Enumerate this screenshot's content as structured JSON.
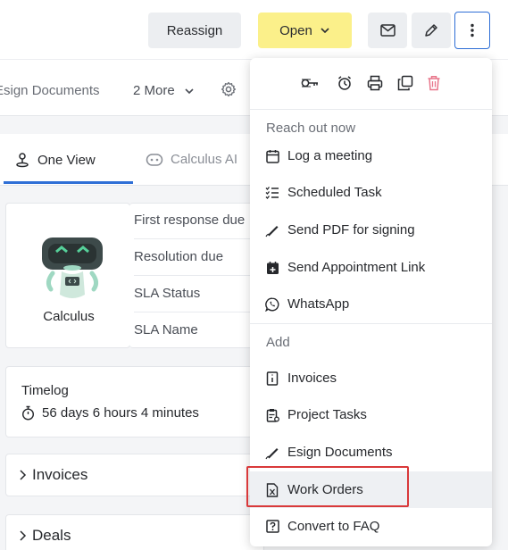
{
  "toolbar": {
    "reassign_label": "Reassign",
    "open_label": "Open"
  },
  "tabs": {
    "esign_label": "Esign Documents",
    "more_label": "2 More"
  },
  "view_tabs": {
    "one_view": "One View",
    "calculus_ai": "Calculus AI"
  },
  "calculus_card": {
    "label": "Calculus"
  },
  "sla": {
    "rows": [
      "First response due",
      "Resolution due",
      "SLA Status",
      "SLA Name"
    ]
  },
  "timelog": {
    "title": "Timelog",
    "value": "56 days 6 hours 4 minutes"
  },
  "sections": {
    "invoices": "Invoices",
    "deals": "Deals"
  },
  "dropdown": {
    "reach_out_title": "Reach out now",
    "add_title": "Add",
    "reach_out_items": [
      {
        "label": "Log a meeting",
        "icon": "calendar-icon"
      },
      {
        "label": "Scheduled Task",
        "icon": "checklist-icon"
      },
      {
        "label": "Send PDF for signing",
        "icon": "signature-icon"
      },
      {
        "label": "Send Appointment Link",
        "icon": "calendar-plus-icon"
      },
      {
        "label": "WhatsApp",
        "icon": "whatsapp-icon"
      }
    ],
    "add_items": [
      {
        "label": "Invoices",
        "icon": "invoice-icon"
      },
      {
        "label": "Project Tasks",
        "icon": "clipboard-icon"
      },
      {
        "label": "Esign Documents",
        "icon": "signature-icon"
      },
      {
        "label": "Work Orders",
        "icon": "work-order-icon"
      },
      {
        "label": "Convert to FAQ",
        "icon": "faq-icon"
      }
    ]
  },
  "colors": {
    "accent": "#2f6fd6",
    "open_button": "#fbf08a",
    "delete_icon": "#e8758a",
    "highlight_box": "#d9393a"
  }
}
